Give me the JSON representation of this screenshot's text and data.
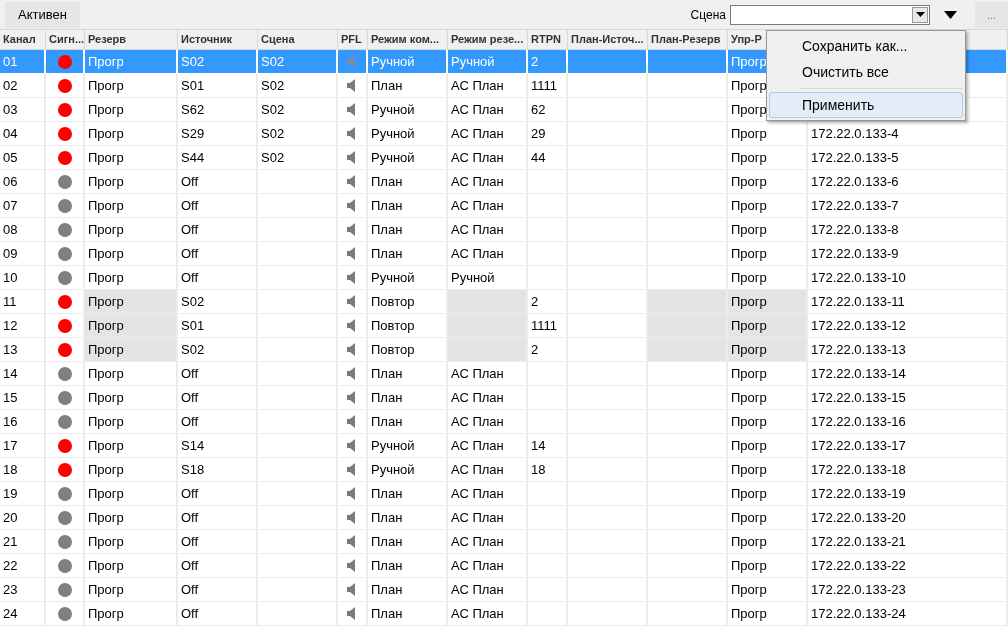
{
  "toolbar": {
    "status_button": "Активен",
    "scene_label": "Сцена",
    "more_button": "..."
  },
  "table": {
    "columns": [
      "Канал",
      "Сигн...",
      "Резерв",
      "Источник",
      "Сцена",
      "PFL",
      "Режим ком...",
      "Режим резе...",
      "RTPN",
      "План-Источ...",
      "План-Резерв",
      "Упр-Р"
    ],
    "rows": [
      {
        "channel": "01",
        "signal": true,
        "reserve": "Прогр",
        "source": "S02",
        "scene": "S02",
        "mode_comm": "Ручной",
        "mode_reserve": "Ручной",
        "rtpn": "2",
        "control": "Прогр",
        "selected": true,
        "shaded": false
      },
      {
        "channel": "02",
        "signal": true,
        "reserve": "Прогр",
        "source": "S01",
        "scene": "S02",
        "mode_comm": "План",
        "mode_reserve": "АС План",
        "rtpn": "1111",
        "control": "Прогр",
        "selected": false,
        "shaded": false
      },
      {
        "channel": "03",
        "signal": true,
        "reserve": "Прогр",
        "source": "S62",
        "scene": "S02",
        "mode_comm": "Ручной",
        "mode_reserve": "АС План",
        "rtpn": "62",
        "control": "Прогр",
        "selected": false,
        "shaded": false
      },
      {
        "channel": "04",
        "signal": true,
        "reserve": "Прогр",
        "source": "S29",
        "scene": "S02",
        "mode_comm": "Ручной",
        "mode_reserve": "АС План",
        "rtpn": "29",
        "control": "Прогр",
        "column_13": "172.22.0.133-4",
        "selected": false,
        "shaded": false
      },
      {
        "channel": "05",
        "signal": true,
        "reserve": "Прогр",
        "source": "S44",
        "scene": "S02",
        "mode_comm": "Ручной",
        "mode_reserve": "АС План",
        "rtpn": "44",
        "control": "Прогр",
        "column_13": "172.22.0.133-5",
        "selected": false,
        "shaded": false
      },
      {
        "channel": "06",
        "signal": false,
        "reserve": "Прогр",
        "source": "Off",
        "mode_comm": "План",
        "mode_reserve": "АС План",
        "control": "Прогр",
        "column_13": "172.22.0.133-6",
        "selected": false,
        "shaded": false
      },
      {
        "channel": "07",
        "signal": false,
        "reserve": "Прогр",
        "source": "Off",
        "mode_comm": "План",
        "mode_reserve": "АС План",
        "control": "Прогр",
        "column_13": "172.22.0.133-7",
        "selected": false,
        "shaded": false
      },
      {
        "channel": "08",
        "signal": false,
        "reserve": "Прогр",
        "source": "Off",
        "mode_comm": "План",
        "mode_reserve": "АС План",
        "control": "Прогр",
        "column_13": "172.22.0.133-8",
        "selected": false,
        "shaded": false
      },
      {
        "channel": "09",
        "signal": false,
        "reserve": "Прогр",
        "source": "Off",
        "mode_comm": "План",
        "mode_reserve": "АС План",
        "control": "Прогр",
        "column_13": "172.22.0.133-9",
        "selected": false,
        "shaded": false
      },
      {
        "channel": "10",
        "signal": false,
        "reserve": "Прогр",
        "source": "Off",
        "mode_comm": "Ручной",
        "mode_reserve": "Ручной",
        "control": "Прогр",
        "column_13": "172.22.0.133-10",
        "selected": false,
        "shaded": false
      },
      {
        "channel": "11",
        "signal": true,
        "reserve": "Прогр",
        "source": "S02",
        "mode_comm": "Повтор",
        "rtpn": "2",
        "control": "Прогр",
        "column_13": "172.22.0.133-11",
        "selected": false,
        "shaded": true
      },
      {
        "channel": "12",
        "signal": true,
        "reserve": "Прогр",
        "source": "S01",
        "mode_comm": "Повтор",
        "rtpn": "1111",
        "control": "Прогр",
        "column_13": "172.22.0.133-12",
        "selected": false,
        "shaded": true
      },
      {
        "channel": "13",
        "signal": true,
        "reserve": "Прогр",
        "source": "S02",
        "mode_comm": "Повтор",
        "rtpn": "2",
        "control": "Прогр",
        "column_13": "172.22.0.133-13",
        "selected": false,
        "shaded": true
      },
      {
        "channel": "14",
        "signal": false,
        "reserve": "Прогр",
        "source": "Off",
        "mode_comm": "План",
        "mode_reserve": "АС План",
        "control": "Прогр",
        "column_13": "172.22.0.133-14",
        "selected": false,
        "shaded": false
      },
      {
        "channel": "15",
        "signal": false,
        "reserve": "Прогр",
        "source": "Off",
        "mode_comm": "План",
        "mode_reserve": "АС План",
        "control": "Прогр",
        "column_13": "172.22.0.133-15",
        "selected": false,
        "shaded": false
      },
      {
        "channel": "16",
        "signal": false,
        "reserve": "Прогр",
        "source": "Off",
        "mode_comm": "План",
        "mode_reserve": "АС План",
        "control": "Прогр",
        "column_13": "172.22.0.133-16",
        "selected": false,
        "shaded": false
      },
      {
        "channel": "17",
        "signal": true,
        "reserve": "Прогр",
        "source": "S14",
        "mode_comm": "Ручной",
        "mode_reserve": "АС План",
        "rtpn": "14",
        "control": "Прогр",
        "column_13": "172.22.0.133-17",
        "selected": false,
        "shaded": false
      },
      {
        "channel": "18",
        "signal": true,
        "reserve": "Прогр",
        "source": "S18",
        "mode_comm": "Ручной",
        "mode_reserve": "АС План",
        "rtpn": "18",
        "control": "Прогр",
        "column_13": "172.22.0.133-18",
        "selected": false,
        "shaded": false
      },
      {
        "channel": "19",
        "signal": false,
        "reserve": "Прогр",
        "source": "Off",
        "mode_comm": "План",
        "mode_reserve": "АС План",
        "control": "Прогр",
        "column_13": "172.22.0.133-19",
        "selected": false,
        "shaded": false
      },
      {
        "channel": "20",
        "signal": false,
        "reserve": "Прогр",
        "source": "Off",
        "mode_comm": "План",
        "mode_reserve": "АС План",
        "control": "Прогр",
        "column_13": "172.22.0.133-20",
        "selected": false,
        "shaded": false
      },
      {
        "channel": "21",
        "signal": false,
        "reserve": "Прогр",
        "source": "Off",
        "mode_comm": "План",
        "mode_reserve": "АС План",
        "control": "Прогр",
        "column_13": "172.22.0.133-21",
        "selected": false,
        "shaded": false
      },
      {
        "channel": "22",
        "signal": false,
        "reserve": "Прогр",
        "source": "Off",
        "mode_comm": "План",
        "mode_reserve": "АС План",
        "control": "Прогр",
        "column_13": "172.22.0.133-22",
        "selected": false,
        "shaded": false
      },
      {
        "channel": "23",
        "signal": false,
        "reserve": "Прогр",
        "source": "Off",
        "mode_comm": "План",
        "mode_reserve": "АС План",
        "control": "Прогр",
        "column_13": "172.22.0.133-23",
        "selected": false,
        "shaded": false
      },
      {
        "channel": "24",
        "signal": false,
        "reserve": "Прогр",
        "source": "Off",
        "mode_comm": "План",
        "mode_reserve": "АС План",
        "control": "Прогр",
        "column_13": "172.22.0.133-24",
        "selected": false,
        "shaded": false
      }
    ]
  },
  "context_menu": {
    "items": [
      {
        "kind": "item",
        "label": "Сохранить как...",
        "selected": false
      },
      {
        "kind": "item",
        "label": "Очистить все",
        "selected": false
      },
      {
        "kind": "separator"
      },
      {
        "kind": "item",
        "label": "Применить",
        "selected": true
      }
    ]
  }
}
